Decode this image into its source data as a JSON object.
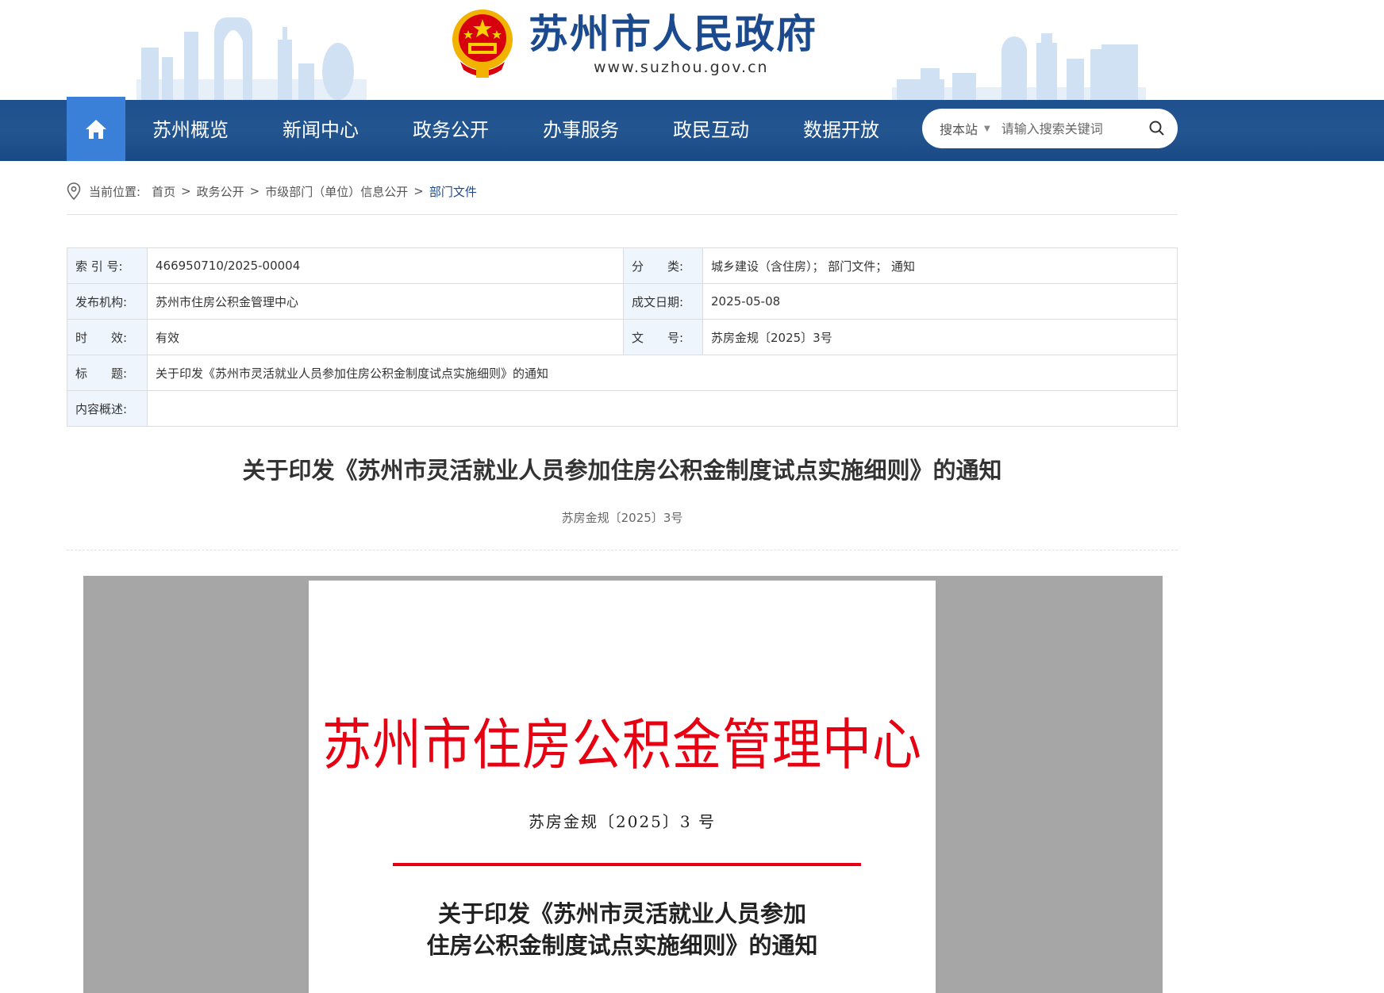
{
  "header": {
    "site_title": "苏州市人民政府",
    "site_url": "www.suzhou.gov.cn"
  },
  "nav": {
    "home_icon": "home-icon",
    "items": [
      "苏州概览",
      "新闻中心",
      "政务公开",
      "办事服务",
      "政民互动",
      "数据开放"
    ],
    "search": {
      "scope": "搜本站",
      "placeholder": "请输入搜索关键词",
      "icon": "search-icon"
    }
  },
  "breadcrumb": {
    "prefix": "当前位置:",
    "items": [
      "首页",
      "政务公开",
      "市级部门（单位）信息公开",
      "部门文件"
    ],
    "separator": ">"
  },
  "meta": {
    "index_label": "索 引 号:",
    "index_value": "466950710/2025-00004",
    "category_label": "分　　类:",
    "category_value": "城乡建设（含住房）；  部门文件；  通知",
    "issuer_label": "发布机构:",
    "issuer_value": "苏州市住房公积金管理中心",
    "date_label": "成文日期:",
    "date_value": "2025-05-08",
    "validity_label": "时　　效:",
    "validity_value": "有效",
    "docno_label": "文　　号:",
    "docno_value": "苏房金规〔2025〕3号",
    "title_label": "标　　题:",
    "title_value": "关于印发《苏州市灵活就业人员参加住房公积金制度试点实施细则》的通知",
    "summary_label": "内容概述:",
    "summary_value": ""
  },
  "article": {
    "title": "关于印发《苏州市灵活就业人员参加住房公积金制度试点实施细则》的通知",
    "doc_no": "苏房金规〔2025〕3号"
  },
  "document": {
    "org_header": "苏州市住房公积金管理中心",
    "doc_no": "苏房金规〔2025〕3 号",
    "title_line1": "关于印发《苏州市灵活就业人员参加",
    "title_line2": "住房公积金制度试点实施细则》的通知"
  },
  "colors": {
    "brand_blue": "#1c4a8e",
    "nav_blue": "#23558f",
    "home_blue": "#3a7fd8",
    "doc_red": "#e60012"
  }
}
